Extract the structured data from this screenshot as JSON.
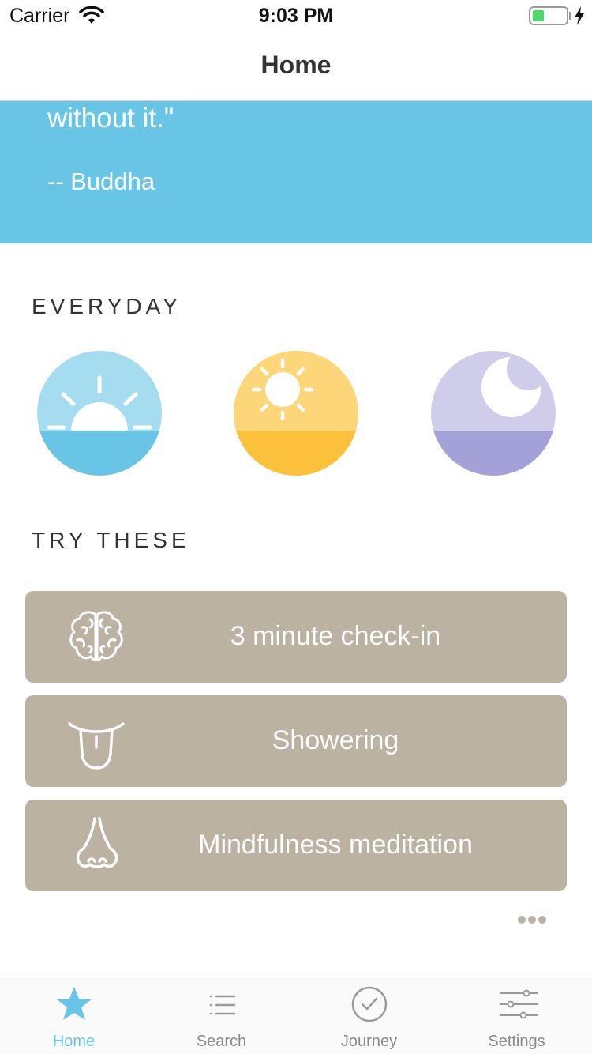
{
  "status_bar": {
    "carrier": "Carrier",
    "time": "9:03 PM"
  },
  "nav": {
    "title": "Home"
  },
  "quote": {
    "text": "without it.\"",
    "author": "-- Buddha"
  },
  "sections": {
    "everyday": "EVERYDAY",
    "try_these": "TRY THESE"
  },
  "everyday_icons": [
    "sunrise-icon",
    "sun-icon",
    "moon-icon"
  ],
  "activities": [
    {
      "label": "3 minute check-in",
      "icon": "brain-icon"
    },
    {
      "label": "Showering",
      "icon": "tongue-icon"
    },
    {
      "label": "Mindfulness meditation",
      "icon": "nose-icon"
    }
  ],
  "tabs": [
    {
      "label": "Home",
      "icon": "star-icon",
      "active": true
    },
    {
      "label": "Search",
      "icon": "list-icon",
      "active": false
    },
    {
      "label": "Journey",
      "icon": "check-circle-icon",
      "active": false
    },
    {
      "label": "Settings",
      "icon": "sliders-icon",
      "active": false
    }
  ],
  "colors": {
    "accent_blue": "#69c5e6",
    "card_taupe": "#bcb2a2",
    "morning_top": "#a6dcf0",
    "morning_bottom": "#69c5e6",
    "day_top": "#fdd67a",
    "day_bottom": "#fbc13a",
    "night_top": "#cfcdea",
    "night_bottom": "#a4a1d8"
  }
}
